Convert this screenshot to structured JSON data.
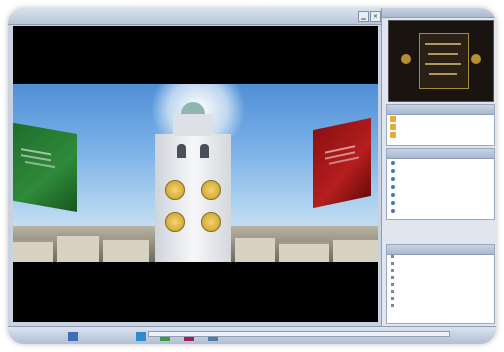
{
  "window": {
    "title": "",
    "controls": {
      "minimize": "▁",
      "close": "×"
    }
  },
  "sidebar": {
    "top_header": "",
    "middle_header": "",
    "list_header": "",
    "bottom_header": "",
    "favorites": [
      {
        "label": "",
        "icon": "folder-icon"
      },
      {
        "label": "",
        "icon": "folder-icon"
      },
      {
        "label": "",
        "icon": "folder-icon"
      }
    ],
    "playlist": [
      {
        "label": "",
        "icon": "media-icon"
      },
      {
        "label": "",
        "icon": "media-icon"
      },
      {
        "label": "",
        "icon": "media-icon"
      },
      {
        "label": "",
        "icon": "media-icon"
      },
      {
        "label": "",
        "icon": "media-icon"
      },
      {
        "label": "",
        "icon": "media-icon"
      },
      {
        "label": "",
        "icon": "media-icon"
      }
    ],
    "info_lines": [
      "",
      "",
      "",
      "",
      "",
      "",
      "",
      ""
    ]
  },
  "player": {
    "progress": 0.0
  },
  "colors": {
    "accent": "#aebcd0",
    "video_bg": "#000000",
    "flag_green": "#2f8a3a",
    "flag_red": "#b51e1e"
  }
}
